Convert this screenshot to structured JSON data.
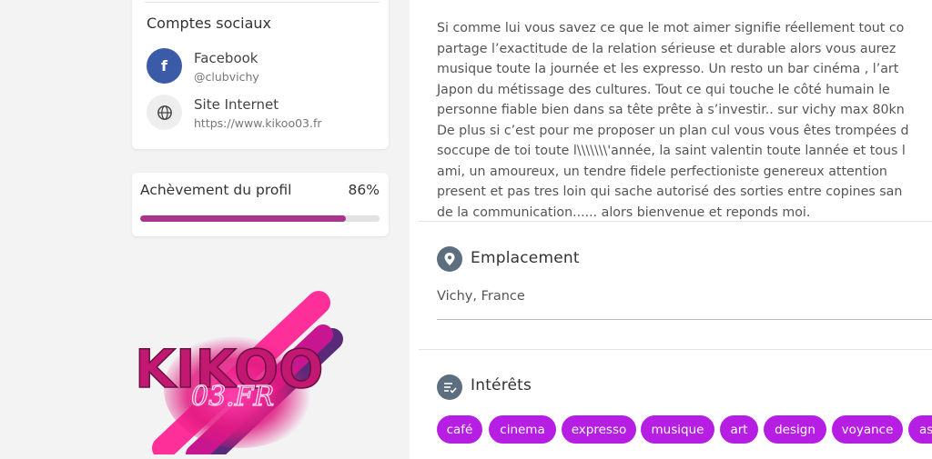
{
  "social": {
    "title": "Comptes sociaux",
    "facebook": {
      "name": "Facebook",
      "handle": "@clubvichy",
      "icon": "facebook-icon"
    },
    "website": {
      "name": "Site Internet",
      "url": "https://www.kikoo03.fr",
      "icon": "globe-icon"
    }
  },
  "profile_completion": {
    "label": "Achèvement du profil",
    "percent_text": "86%",
    "value": 0.86,
    "color": "#a8348c"
  },
  "logo": {
    "text_main": "KIKOO",
    "text_sub": "03.FR"
  },
  "about": {
    "lines": [
      "Si comme lui vous savez ce que le mot aimer signifie réellement tout co",
      "partage l’exactitude de la relation sérieuse et durable alors vous aurez",
      "musique toute la journée et les expresso. Un resto un bar cinéma , l’art",
      "Japon du métissage des cultures. Tout ce qui touche le côté humain le",
      "personne fiable bien dans sa tête prête à s’investir.. sur vichy max 80kn",
      "De plus si c’est pour me proposer un plan cul vous vous êtes trompées d",
      "soccupe de toi toute l\\\\\\\\\\\\\\'année, la saint valentin toute lannée et tous l",
      "ami, un amoureux, un tendre fidele perfectioniste genereux attention",
      "present et pas tres loin qui sache autorisé des sorties entre copines san",
      "de la communication...... alors bienvenue et reponds moi."
    ]
  },
  "location": {
    "title": "Emplacement",
    "value": "Vichy, France",
    "icon": "location-pin-icon"
  },
  "interests": {
    "title": "Intérêts",
    "icon": "interests-list-icon",
    "tag_color": "#b61fe3",
    "tags": [
      "café",
      "cinema",
      "expresso",
      "musique",
      "art",
      "design",
      "voyance",
      "as"
    ]
  }
}
